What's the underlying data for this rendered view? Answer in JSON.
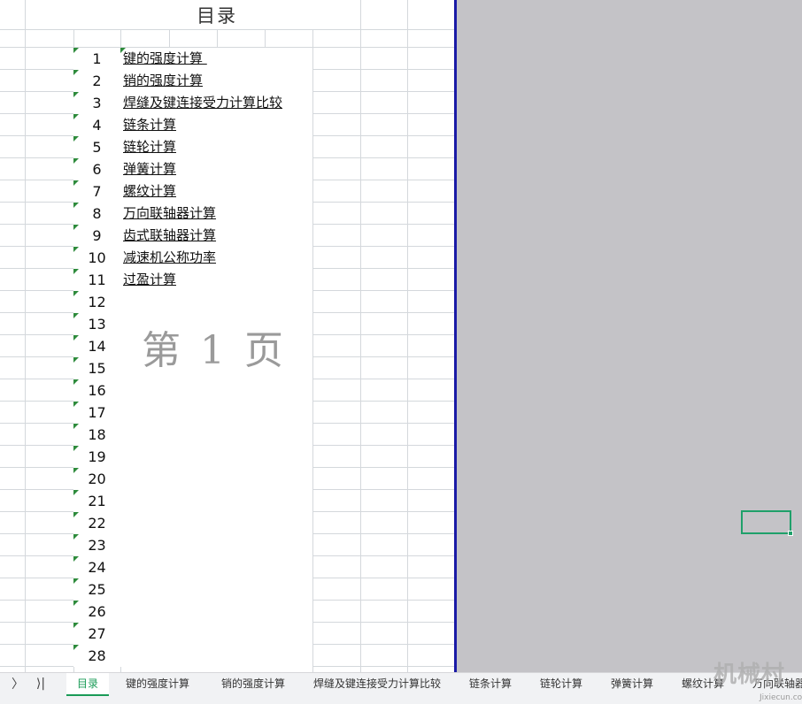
{
  "sheet": {
    "title": "目录",
    "watermark": "第 1 页",
    "rows": [
      {
        "num": "1",
        "link": "键的强度计算 "
      },
      {
        "num": "2",
        "link": "销的强度计算"
      },
      {
        "num": "3",
        "link": "焊缝及键连接受力计算比较"
      },
      {
        "num": "4",
        "link": "链条计算"
      },
      {
        "num": "5",
        "link": "链轮计算"
      },
      {
        "num": "6",
        "link": "弹簧计算"
      },
      {
        "num": "7",
        "link": "螺纹计算"
      },
      {
        "num": "8",
        "link": "万向联轴器计算"
      },
      {
        "num": "9",
        "link": "齿式联轴器计算"
      },
      {
        "num": "10",
        "link": "减速机公称功率"
      },
      {
        "num": "11",
        "link": "过盈计算"
      },
      {
        "num": "12",
        "link": ""
      },
      {
        "num": "13",
        "link": ""
      },
      {
        "num": "14",
        "link": ""
      },
      {
        "num": "15",
        "link": ""
      },
      {
        "num": "16",
        "link": ""
      },
      {
        "num": "17",
        "link": ""
      },
      {
        "num": "18",
        "link": ""
      },
      {
        "num": "19",
        "link": ""
      },
      {
        "num": "20",
        "link": ""
      },
      {
        "num": "21",
        "link": ""
      },
      {
        "num": "22",
        "link": ""
      },
      {
        "num": "23",
        "link": ""
      },
      {
        "num": "24",
        "link": ""
      },
      {
        "num": "25",
        "link": ""
      },
      {
        "num": "26",
        "link": ""
      },
      {
        "num": "27",
        "link": ""
      },
      {
        "num": "28",
        "link": ""
      }
    ]
  },
  "tabbar": {
    "next_icon": "chevron-right-icon",
    "last_icon": "chevron-last-icon",
    "next_glyph": "〉",
    "last_glyph": "⟩|",
    "tabs": [
      {
        "label": "目录",
        "active": true
      },
      {
        "label": "键的强度计算"
      },
      {
        "label": "销的强度计算"
      },
      {
        "label": "焊缝及键连接受力计算比较"
      },
      {
        "label": "链条计算"
      },
      {
        "label": "链轮计算"
      },
      {
        "label": "弹簧计算"
      },
      {
        "label": "螺纹计算"
      },
      {
        "label": "万向联轴器"
      }
    ]
  },
  "branding": {
    "logo_text": "机械村",
    "logo_sub": "Jixiecun.com"
  },
  "colors": {
    "accent": "#1a9b57",
    "page_break": "#1a1aa6",
    "outside_print_area": "#c4c3c7",
    "selection": "#1fa06a"
  }
}
